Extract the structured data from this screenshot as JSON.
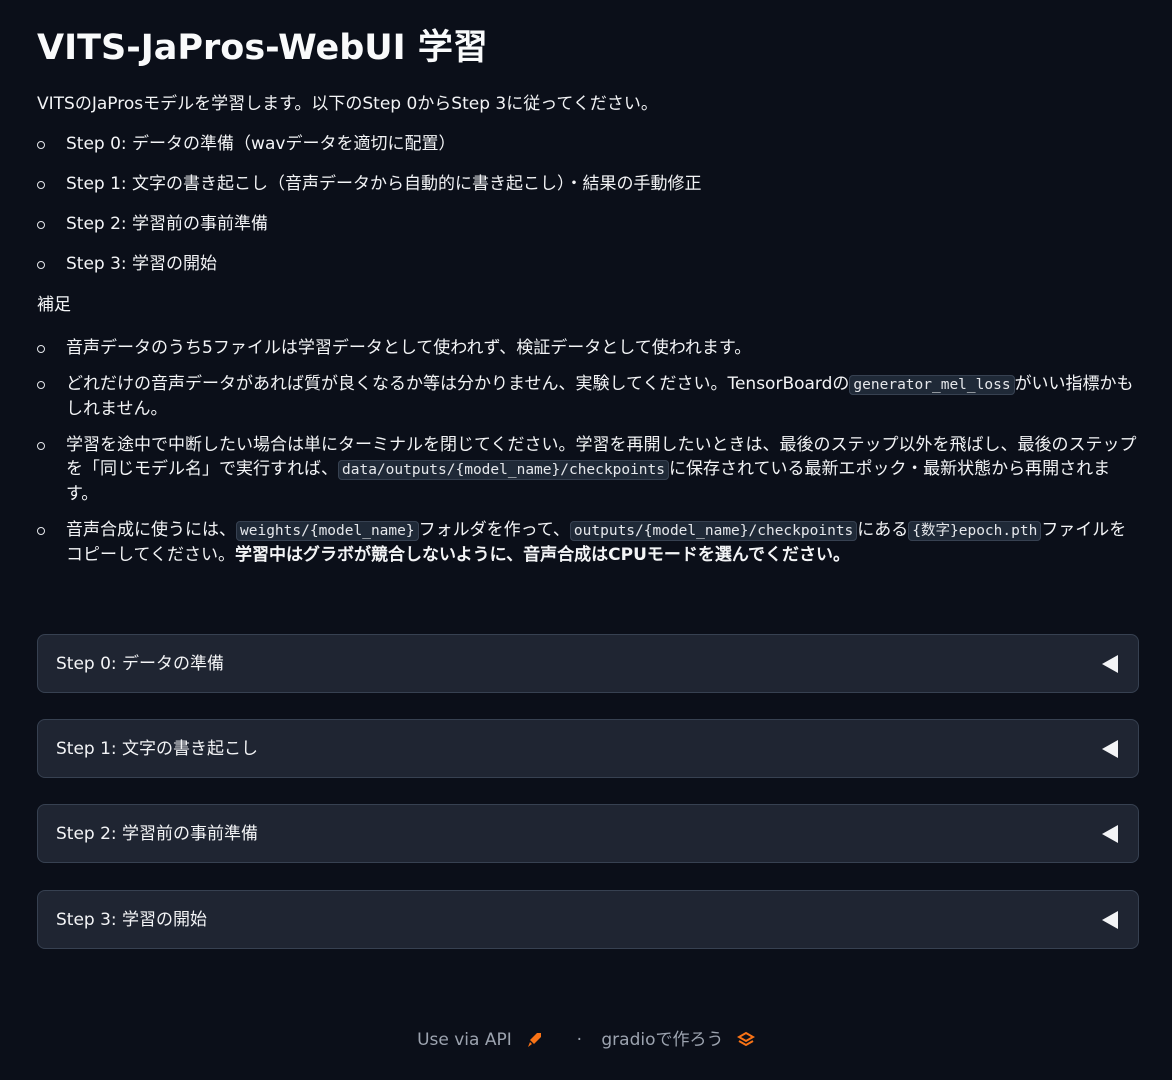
{
  "header": {
    "title": "VITS-JaPros-WebUI 学習"
  },
  "intro": "VITSのJaProsモデルを学習します。以下のStep 0からStep 3に従ってください。",
  "steps": [
    "Step 0: データの準備（wavデータを適切に配置）",
    "Step 1: 文字の書き起こし（音声データから自動的に書き起こし）・結果の手動修正",
    "Step 2: 学習前の事前準備",
    "Step 3: 学習の開始"
  ],
  "supplement": {
    "title": "補足",
    "note1": "音声データのうち5ファイルは学習データとして使われず、検証データとして使われます。",
    "note2": {
      "a": "どれだけの音声データがあれば質が良くなるか等は分かりません、実験してください。TensorBoardの",
      "code": "generator_mel_loss",
      "b": "がいい指標かもしれません。"
    },
    "note3": {
      "a": "学習を途中で中断したい場合は単にターミナルを閉じてください。学習を再開したいときは、最後のステップ以外を飛ばし、最後のステップを「同じモデル名」で実行すれば、",
      "code": "data/outputs/{model_name}/checkpoints",
      "b": "に保存されている最新エポック・最新状態から再開されます。"
    },
    "note4": {
      "a": "音声合成に使うには、",
      "code1": "weights/{model_name}",
      "b": "フォルダを作って、",
      "code2": "outputs/{model_name}/checkpoints",
      "c": "にある",
      "code3": "{数字}epoch.pth",
      "d": "ファイルをコピーしてください。",
      "bold": "学習中はグラボが競合しないように、音声合成はCPUモードを選んでください。"
    }
  },
  "accordions": [
    {
      "label": "Step 0: データの準備"
    },
    {
      "label": "Step 1: 文字の書き起こし"
    },
    {
      "label": "Step 2: 学習前の事前準備"
    },
    {
      "label": "Step 3: 学習の開始"
    }
  ],
  "footer": {
    "api_label": "Use via API",
    "separator": "·",
    "gradio_label": "gradioで作ろう"
  },
  "colors": {
    "background": "#0b0f19",
    "panel": "#1f2532",
    "accent": "#f97316"
  },
  "icons": {
    "accordion": "triangle-left-icon",
    "api": "rocket-icon",
    "gradio": "gradio-logo-icon"
  }
}
